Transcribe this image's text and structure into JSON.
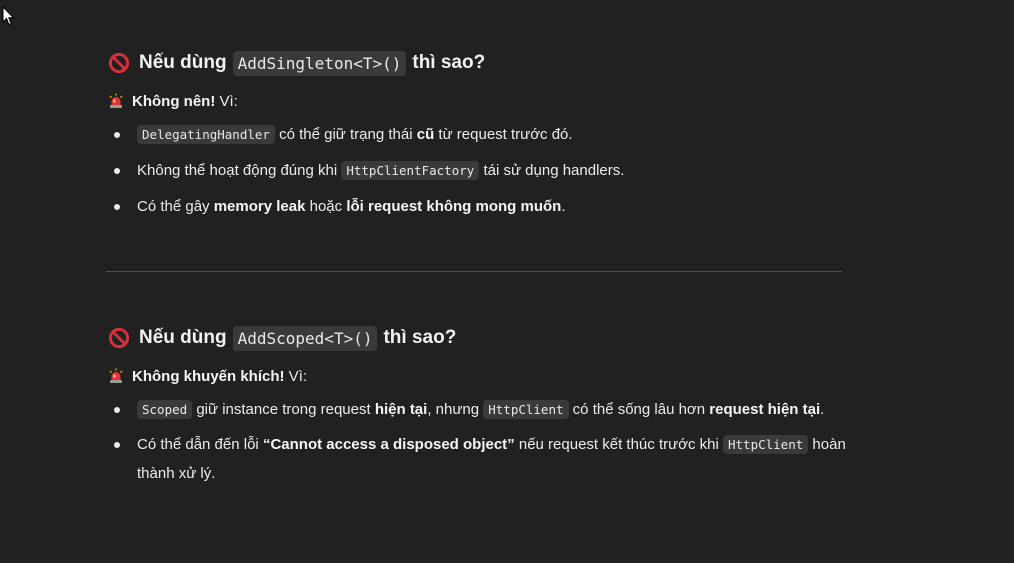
{
  "colors": {
    "background": "#212121",
    "text": "#ececec",
    "code_bg": "#3a3a3a",
    "divider": "#4e4e4e",
    "prohibited_red": "#d6303f",
    "siren_red": "#e2342f"
  },
  "icons": {
    "heading_icon": "prohibited-icon",
    "subline_icon": "police-car-light-icon",
    "cursor": "mouse-pointer-icon"
  },
  "sections": [
    {
      "heading_pre": "Nếu dùng",
      "heading_code": "AddSingleton<T>()",
      "heading_post": "thì sao?",
      "sub_bold": "Không nên!",
      "sub_rest": " Vì:",
      "items": [
        {
          "code1": "DelegatingHandler",
          "t1": " có thể giữ trạng thái ",
          "b1": "cũ",
          "t2": " từ request trước đó."
        },
        {
          "t1": "Không thể hoạt động đúng khi ",
          "code1": "HttpClientFactory",
          "t2": " tái sử dụng handlers."
        },
        {
          "t1": "Có thể gây ",
          "b1": "memory leak",
          "t2": " hoặc ",
          "b2": "lỗi request không mong muốn",
          "t3": "."
        }
      ]
    },
    {
      "heading_pre": "Nếu dùng",
      "heading_code": "AddScoped<T>()",
      "heading_post": "thì sao?",
      "sub_bold": "Không khuyến khích!",
      "sub_rest": " Vì:",
      "items": [
        {
          "code1": "Scoped",
          "t1": " giữ instance trong request ",
          "b1": "hiện tại",
          "t2": ", nhưng ",
          "code2": "HttpClient",
          "t3": " có thể sống lâu hơn ",
          "b2": "request hiện tại",
          "t4": "."
        },
        {
          "t1": "Có thể dẫn đến lỗi ",
          "b1": "“Cannot access a disposed object”",
          "t2": " nếu request kết thúc trước khi ",
          "code1": "HttpClient",
          "t3": " hoàn thành xử lý."
        }
      ]
    }
  ]
}
